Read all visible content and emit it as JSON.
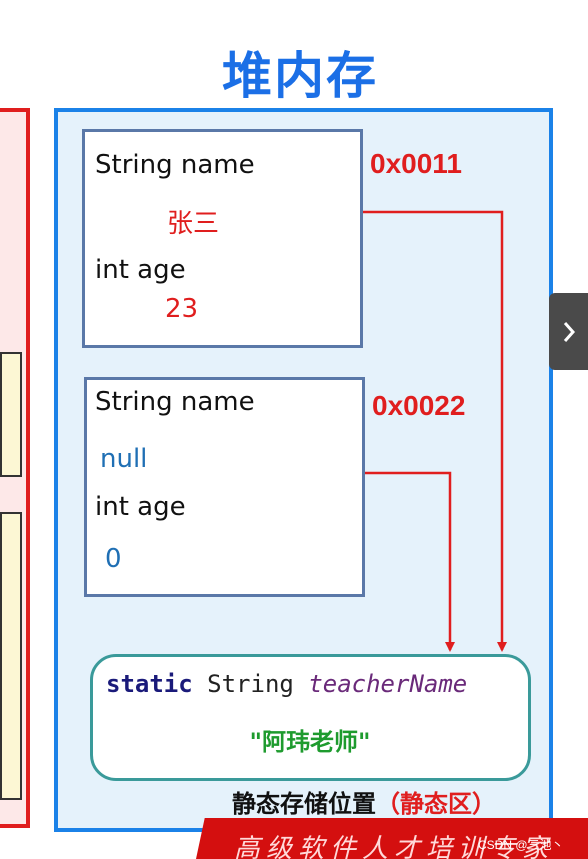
{
  "heap": {
    "title": "堆内存"
  },
  "objects": [
    {
      "address": "0x0011",
      "name_label": "String name",
      "name_value": "张三",
      "age_label": "int age",
      "age_value": "23"
    },
    {
      "address": "0x0022",
      "name_label": "String name",
      "name_value": "null",
      "age_label": "int age",
      "age_value": "0"
    }
  ],
  "static_area": {
    "keyword": "static",
    "type": "String",
    "field": "teacherName",
    "value": "\"阿玮老师\"",
    "caption": "静态存储位置",
    "caption_highlight": "（静态区）"
  },
  "banner": {
    "text": "高级软件人才培训专家"
  },
  "watermark": {
    "text": "CSDN @三池丶"
  },
  "colors": {
    "heap_border": "#1b82e8",
    "heap_fill": "#e5f2fb",
    "title": "#1b6fe6",
    "address": "#e01e1e",
    "arrow": "#e01e1e",
    "static_border": "#3a9a9a",
    "string_value": "#1e9b2e",
    "stack_border": "#e01e1e"
  },
  "icons": {
    "next": "chevron-right-icon"
  }
}
